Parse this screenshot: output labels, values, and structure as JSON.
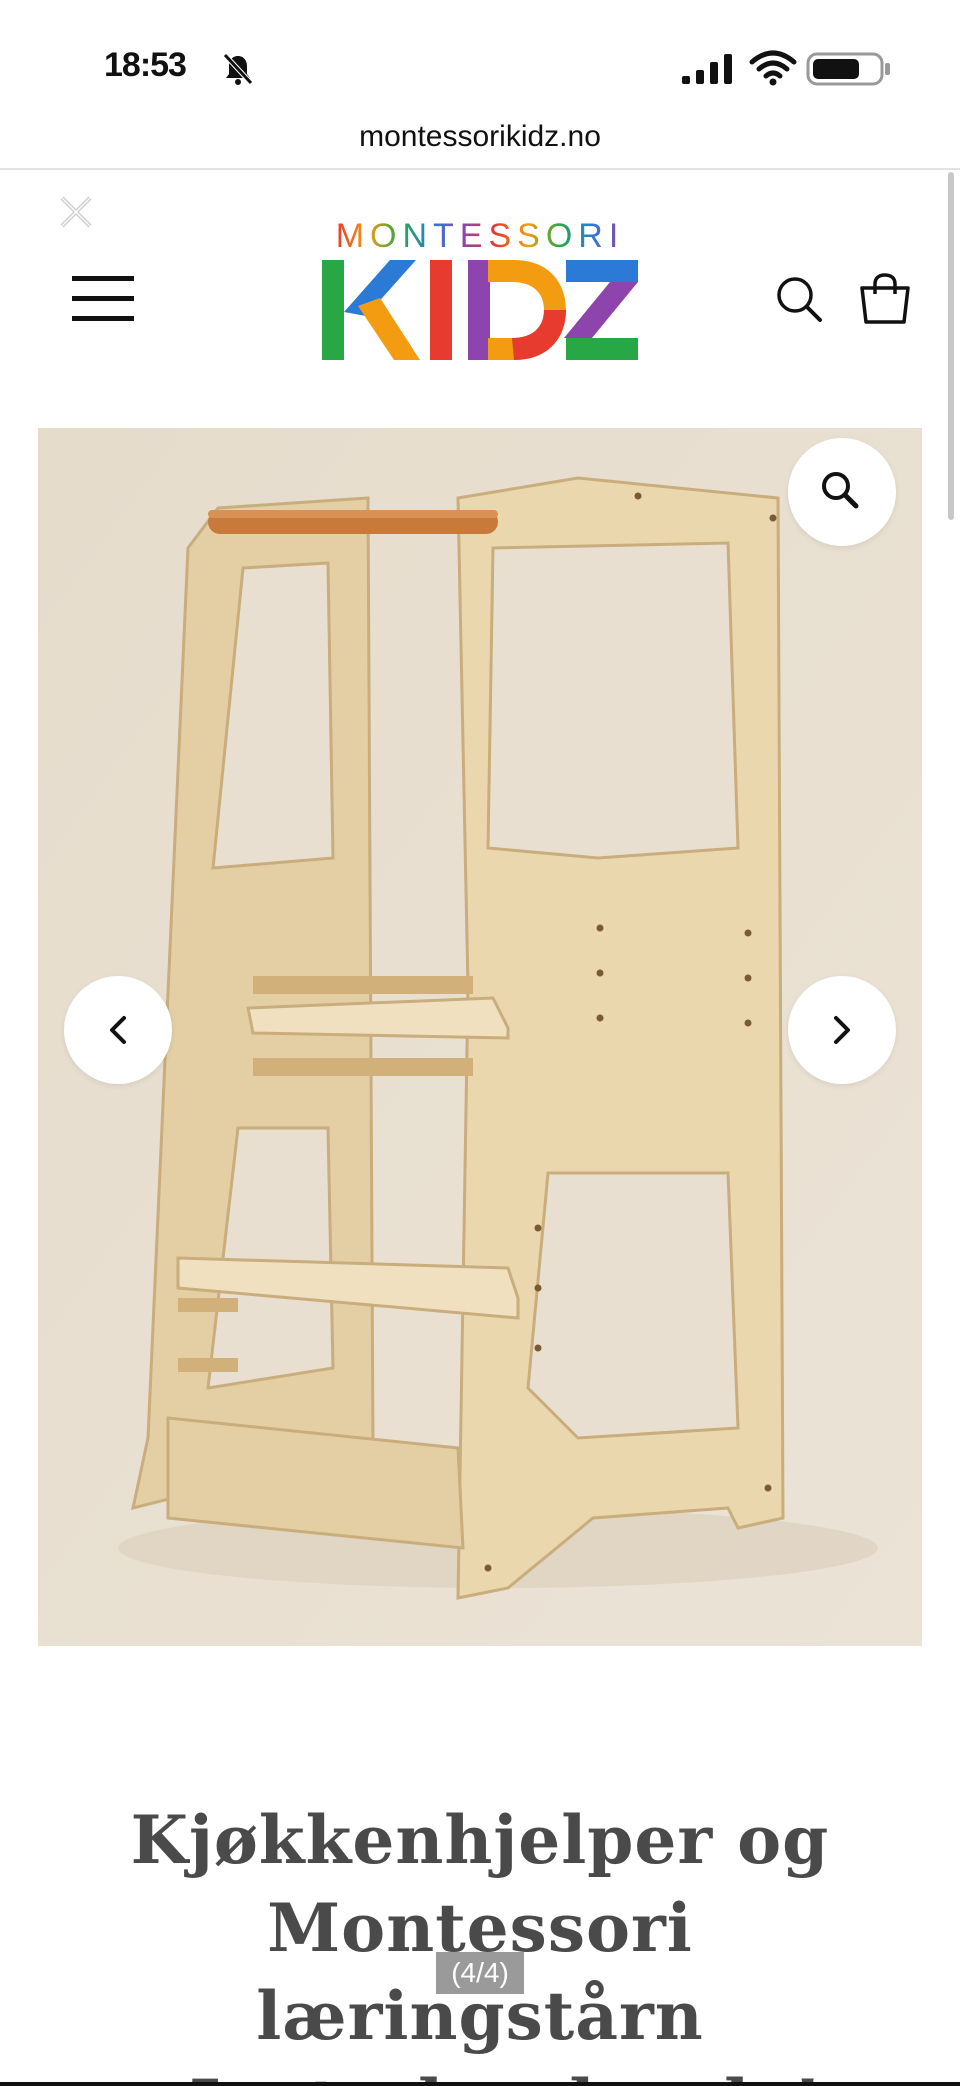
{
  "status_bar": {
    "time": "18:53",
    "icons": [
      "bell-slash-icon",
      "signal-icon",
      "wifi-icon",
      "battery-icon"
    ]
  },
  "browser": {
    "url": "montessorikidz.no"
  },
  "header": {
    "logo_top": "MONTESSORI",
    "logo_bottom": "KIDZ",
    "icons": [
      "close-icon",
      "menu-icon",
      "search-icon",
      "shopping-bag-icon"
    ]
  },
  "gallery": {
    "image_alt": "Kjøkkenhjelper læringstårn i bjørkefiner",
    "counter": "(4/4)",
    "controls": [
      "zoom-icon",
      "chevron-left-icon",
      "chevron-right-icon"
    ]
  },
  "product": {
    "title_line1": "Kjøkkenhjelper og",
    "title_line2": "Montessori læringstårn",
    "title_line3": "- Justerbar høyde!"
  },
  "colors": {
    "logo_m": "#e63b2e",
    "logo_o": "#f39c12",
    "logo_n": "#27a845",
    "logo_t": "#2b7bd6",
    "logo_e": "#8e44ad",
    "background_photo": "#e9dfd0",
    "wood": "#e8d3a8",
    "handle": "#c87a3a",
    "title": "#4a4a4a"
  }
}
